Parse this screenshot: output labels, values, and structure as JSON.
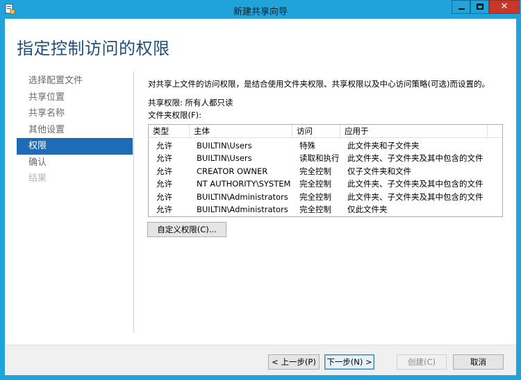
{
  "window": {
    "title": "新建共享向导",
    "controls": {
      "minimize_icon": "minimize-icon",
      "maximize_icon": "maximize-icon",
      "close_glyph": "✕"
    }
  },
  "page": {
    "heading": "指定控制访问的权限"
  },
  "nav": {
    "items": [
      {
        "label": "选择配置文件",
        "state": "normal"
      },
      {
        "label": "共享位置",
        "state": "normal"
      },
      {
        "label": "共享名称",
        "state": "normal"
      },
      {
        "label": "其他设置",
        "state": "normal"
      },
      {
        "label": "权限",
        "state": "active"
      },
      {
        "label": "确认",
        "state": "normal"
      },
      {
        "label": "结果",
        "state": "disabled"
      }
    ]
  },
  "content": {
    "intro": "对共享上文件的访问权限，是结合使用文件夹权限、共享权限以及中心访问策略(可选)而设置的。",
    "share_permission": "共享权限: 所有人都只读",
    "folder_permission_label": "文件夹权限(F):",
    "table": {
      "columns": [
        "类型",
        "主体",
        "访问",
        "应用于"
      ],
      "rows": [
        [
          "允许",
          "BUILTIN\\Users",
          "特殊",
          "此文件夹和子文件夹"
        ],
        [
          "允许",
          "BUILTIN\\Users",
          "读取和执行",
          "此文件夹、子文件夹及其中包含的文件"
        ],
        [
          "允许",
          "CREATOR OWNER",
          "完全控制",
          "仅子文件夹和文件"
        ],
        [
          "允许",
          "NT AUTHORITY\\SYSTEM",
          "完全控制",
          "此文件夹、子文件夹及其中包含的文件"
        ],
        [
          "允许",
          "BUILTIN\\Administrators",
          "完全控制",
          "此文件夹、子文件夹及其中包含的文件"
        ],
        [
          "允许",
          "BUILTIN\\Administrators",
          "完全控制",
          "仅此文件夹"
        ]
      ]
    },
    "customize_button": "自定义权限(C)..."
  },
  "footer": {
    "back": "< 上一步(P)",
    "next": "下一步(N) >",
    "create": "创建(C)",
    "cancel": "取消"
  },
  "colors": {
    "titlebar": "#1fa3da",
    "heading": "#1e4e79",
    "nav_active": "#1e6bb8",
    "close_button": "#c7382b"
  }
}
